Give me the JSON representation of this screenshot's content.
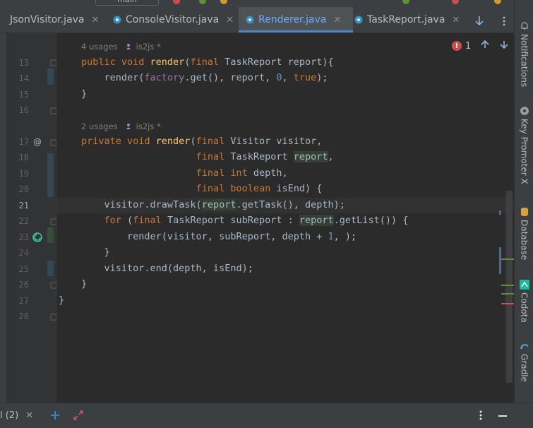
{
  "tabs": [
    {
      "label": "JsonVisitor.java",
      "active": false,
      "icon": "java-class-icon"
    },
    {
      "label": "ConsoleVisitor.java",
      "active": false,
      "icon": "java-class-icon"
    },
    {
      "label": "Renderer.java",
      "active": true,
      "icon": "java-class-icon"
    },
    {
      "label": "TaskReport.java",
      "active": false,
      "icon": "java-class-icon"
    }
  ],
  "toolbar": {
    "branch_label": "main"
  },
  "right_tools": [
    {
      "label": "Notifications",
      "icon": "bell-icon"
    },
    {
      "label": "Key Promoter X",
      "icon": "key-promoter-icon"
    },
    {
      "label": "Database",
      "icon": "database-icon"
    },
    {
      "label": "Codota",
      "icon": "codota-icon"
    },
    {
      "label": "Gradle",
      "icon": "gradle-icon"
    }
  ],
  "editor": {
    "error_count": "1",
    "hints": [
      {
        "usages": "4 usages",
        "author": "is2js *"
      },
      {
        "usages": "2 usages",
        "author": "is2js *"
      }
    ],
    "line_numbers": [
      "13",
      "14",
      "15",
      "16",
      "17",
      "18",
      "19",
      "20",
      "21",
      "22",
      "23",
      "24",
      "25",
      "26",
      "27",
      "28"
    ],
    "current_line": "21"
  },
  "bottom": {
    "run_tab_label": "l (2)"
  },
  "colors": {
    "background": "#2b2b2b",
    "keyword": "#cc7832",
    "method": "#ffc66d",
    "number": "#6897bb",
    "active_tab_text": "#6aaeff",
    "error": "#c94f4f",
    "accent": "#4a88c7"
  }
}
